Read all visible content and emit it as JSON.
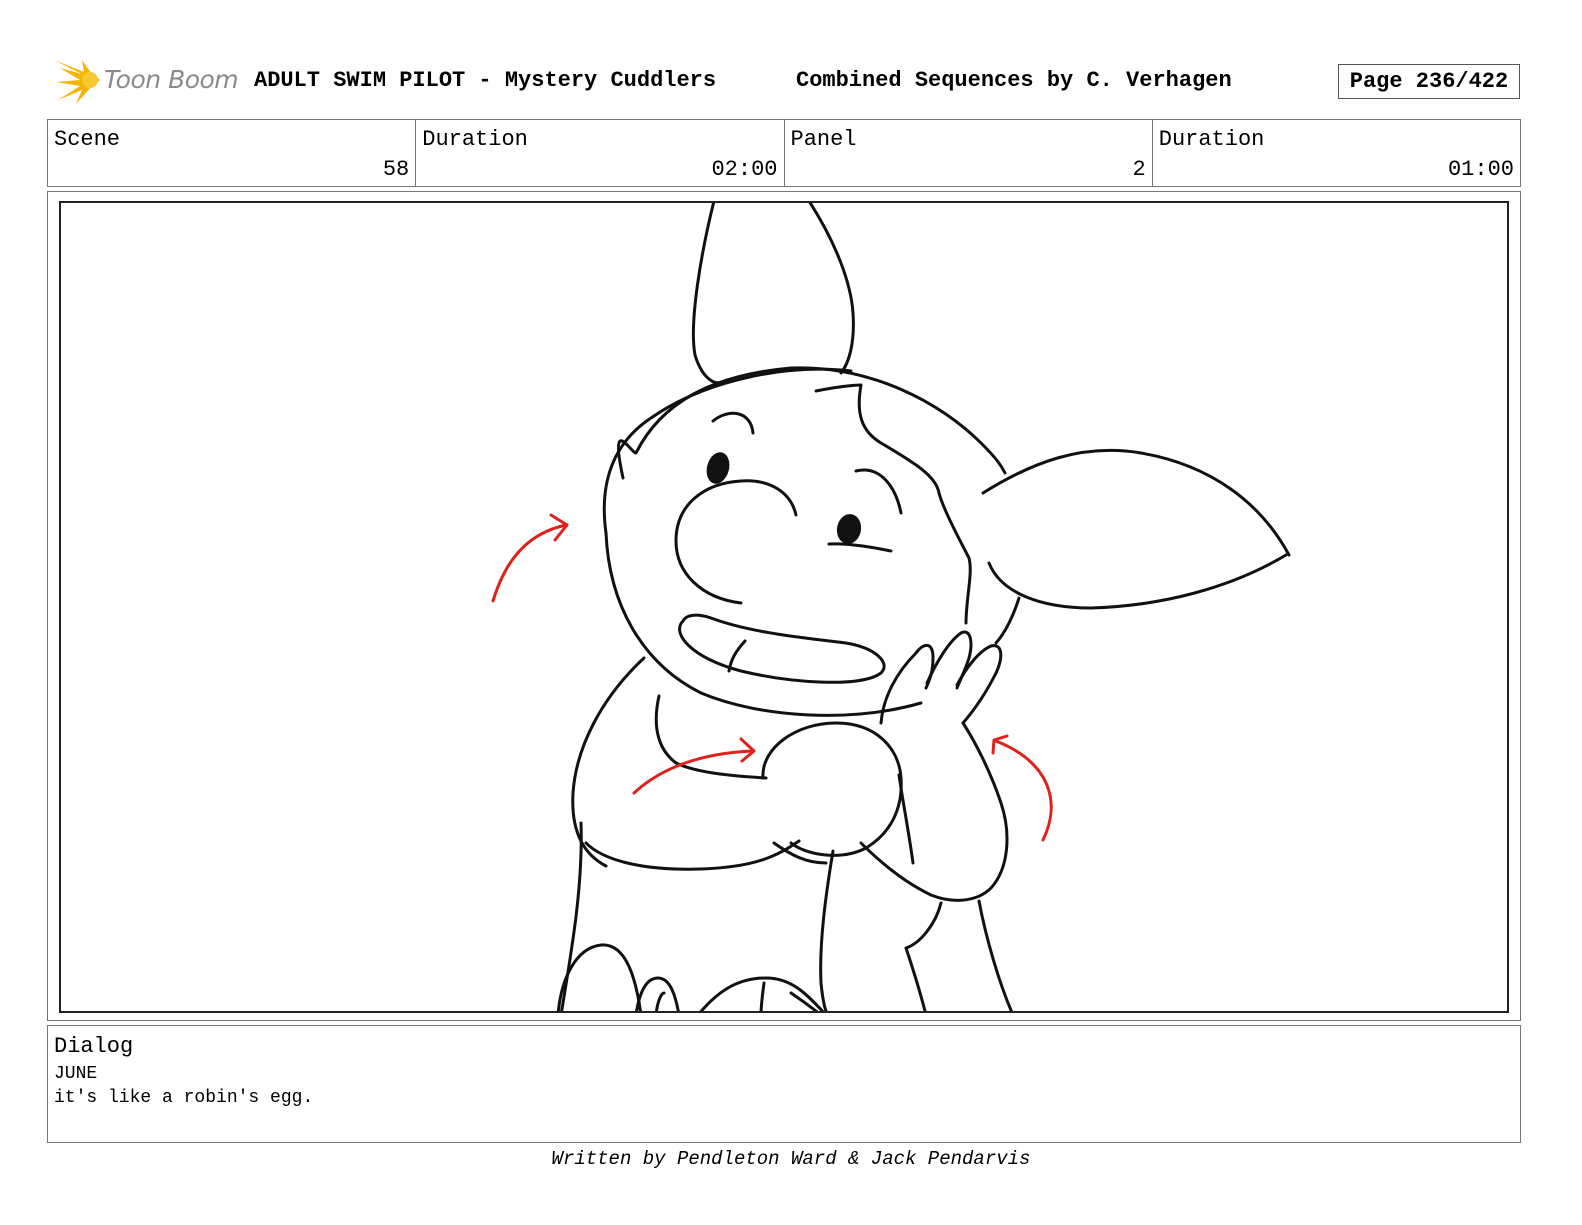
{
  "header": {
    "logo_text": "Toon Boom",
    "project_title": "ADULT SWIM PILOT - Mystery Cuddlers",
    "sequence_title": "Combined Sequences by C. Verhagen",
    "page_label": "Page 236/422"
  },
  "info": {
    "scene_label": "Scene",
    "scene_value": "58",
    "scene_duration_label": "Duration",
    "scene_duration_value": "02:00",
    "panel_label": "Panel",
    "panel_value": "2",
    "panel_duration_label": "Duration",
    "panel_duration_value": "01:00"
  },
  "dialog": {
    "label": "Dialog",
    "speaker": "JUNE",
    "line": "it's like a robin's egg."
  },
  "footer": {
    "credit": "Written by Pendleton Ward & Jack Pendarvis"
  },
  "colors": {
    "logo_accent": "#f5b400",
    "arrow": "#e0201b",
    "ink": "#111111"
  }
}
